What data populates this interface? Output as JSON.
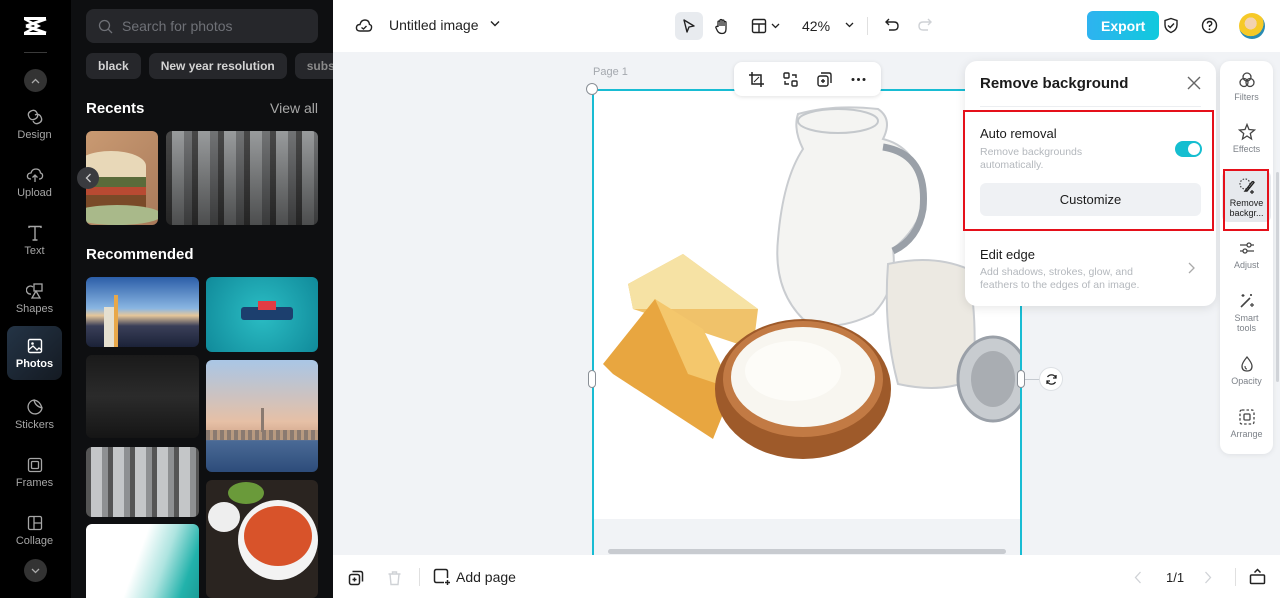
{
  "app": {
    "name": "CapCut"
  },
  "rail": {
    "items": [
      {
        "label": "Design",
        "icon": "design-icon"
      },
      {
        "label": "Upload",
        "icon": "upload-icon"
      },
      {
        "label": "Text",
        "icon": "text-icon"
      },
      {
        "label": "Shapes",
        "icon": "shapes-icon"
      },
      {
        "label": "Photos",
        "icon": "photos-icon",
        "active": true
      },
      {
        "label": "Stickers",
        "icon": "stickers-icon"
      },
      {
        "label": "Frames",
        "icon": "frames-icon"
      },
      {
        "label": "Collage",
        "icon": "collage-icon"
      }
    ]
  },
  "panel": {
    "search_placeholder": "Search for photos",
    "chips": [
      "black",
      "New year resolution",
      "subs"
    ],
    "recents_title": "Recents",
    "view_all": "View all",
    "recommended_title": "Recommended",
    "recents": [
      "burger",
      "temple pillars"
    ],
    "recommended": [
      "city skyline at dusk",
      "tugboat on turquoise sea",
      "dark texture",
      "city skyline over water",
      "temple pillars",
      "ramen meal",
      "teal abstract"
    ]
  },
  "topbar": {
    "doc_title": "Untitled image",
    "zoom": "42%",
    "export_label": "Export",
    "brand_color": "#18bcd3"
  },
  "canvas": {
    "page_label": "Page 1",
    "image_description": "dairy products: milk jug, cheese, cottage cheese, jar"
  },
  "popup": {
    "title": "Remove background",
    "auto_title": "Auto removal",
    "auto_desc": "Remove backgrounds automatically.",
    "auto_enabled": true,
    "customize_label": "Customize",
    "edge_title": "Edit edge",
    "edge_desc": "Add shadows, strokes, glow, and feathers to the edges of an image."
  },
  "right_rail": {
    "items": [
      {
        "label": "Filters"
      },
      {
        "label": "Effects"
      },
      {
        "label": "Remove backgr...",
        "active": true
      },
      {
        "label": "Adjust"
      },
      {
        "label": "Smart tools"
      },
      {
        "label": "Opacity"
      },
      {
        "label": "Arrange"
      }
    ]
  },
  "bottombar": {
    "add_page": "Add page",
    "page_count": "1/1"
  }
}
